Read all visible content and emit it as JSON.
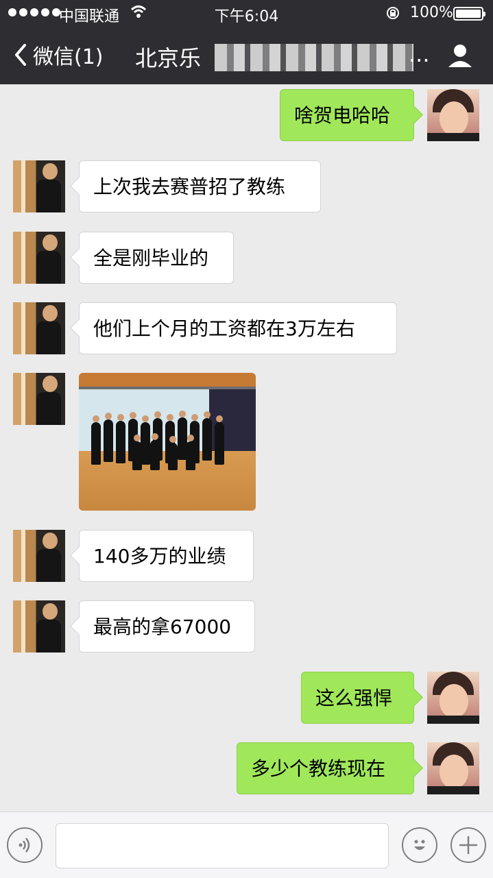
{
  "status_bar": {
    "carrier": "中国联通",
    "time": "下午6:04",
    "battery": "100%"
  },
  "nav": {
    "back_label": "微信(1)",
    "title": "北京乐",
    "title_suffix": "..."
  },
  "messages": [
    {
      "side": "right",
      "text": "啥贺电哈哈"
    },
    {
      "side": "left",
      "text": "上次我去赛普招了教练"
    },
    {
      "side": "left",
      "text": "全是刚毕业的"
    },
    {
      "side": "left",
      "text": "他们上个月的工资都在3万左右"
    },
    {
      "side": "left",
      "type": "image"
    },
    {
      "side": "left",
      "text": "140多万的业绩"
    },
    {
      "side": "left",
      "text": "最高的拿67000"
    },
    {
      "side": "right",
      "text": "这么强悍"
    },
    {
      "side": "right",
      "text": "多少个教练现在"
    }
  ],
  "input": {
    "value": ""
  },
  "icons": {
    "back": "chevron-left-icon",
    "profile": "person-icon",
    "voice": "voice-icon",
    "emoji": "emoji-icon",
    "plus": "plus-icon"
  }
}
